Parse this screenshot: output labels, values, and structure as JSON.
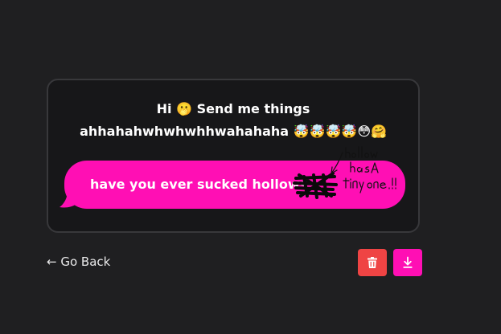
{
  "prompt": {
    "line1": "Hi 🫢 Send me things",
    "line2": "ahhahahwhwhwhhwahahaha 🤯🤯🤯🤯😳🤗"
  },
  "message": {
    "text": "have you ever sucked hollows",
    "annotation": "hollow has a tiny one.!!"
  },
  "nav": {
    "back_label": "← Go Back"
  },
  "actions": {
    "delete_icon": "trash-icon",
    "download_icon": "download-icon"
  },
  "colors": {
    "background": "#1f1f21",
    "card": "#171719",
    "card_border": "#38383b",
    "bubble": "#ff0fb4",
    "delete_button": "#ef4444",
    "download_button": "#ff0fb4"
  }
}
